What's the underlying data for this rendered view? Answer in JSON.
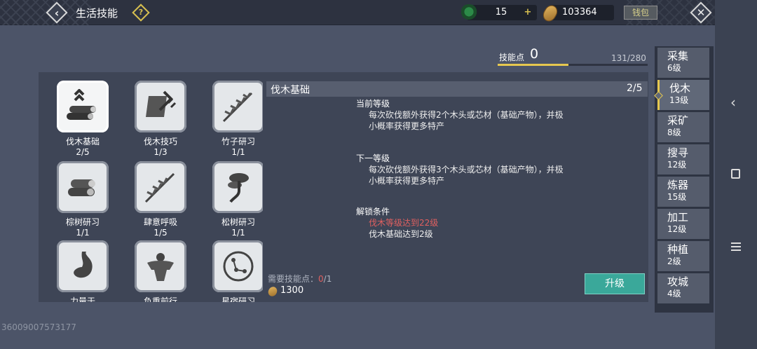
{
  "header": {
    "title": "生活技能",
    "help_glyph": "?",
    "jade_count": "15",
    "plus_glyph": "+",
    "coin_count": "103364",
    "wallet_label": "钱包"
  },
  "skill_points": {
    "label": "技能点",
    "value": "0",
    "count": "131/280",
    "fill_fraction": 0.47
  },
  "skills": [
    {
      "name": "伐木基础",
      "level": "2/5",
      "icon": "logs-icon"
    },
    {
      "name": "伐木技巧",
      "level": "1/3",
      "icon": "axe-scroll-icon"
    },
    {
      "name": "竹子研习",
      "level": "1/1",
      "icon": "bamboo-branch-icon"
    },
    {
      "name": "棕树研习",
      "level": "1/1",
      "icon": "log-pile-icon"
    },
    {
      "name": "肆意呼吸",
      "level": "1/5",
      "icon": "branch-icon"
    },
    {
      "name": "松树研习",
      "level": "1/1",
      "icon": "pine-tree-icon"
    },
    {
      "name": "力量于",
      "level": "",
      "icon": "stomach-icon"
    },
    {
      "name": "负重前行",
      "level": "",
      "icon": "muscle-icon"
    },
    {
      "name": "星宿研习",
      "level": "",
      "icon": "constellation-icon"
    }
  ],
  "detail": {
    "name": "伐木基础",
    "level": "2/5",
    "current_heading": "当前等级",
    "current_text": "每次砍伐额外获得2个木头或芯材（基础产物），并极小概率获得更多特产",
    "next_heading": "下一等级",
    "next_text": "每次砍伐额外获得3个木头或芯材（基础产物），并极小概率获得更多特产",
    "unlock_heading": "解锁条件",
    "unlock_cond1": "伐木等级达到22级",
    "unlock_cond2": "伐木基础达到2级",
    "cost_label": "需要技能点：",
    "cost_have": "0",
    "cost_need": "/1",
    "coin_cost": "1300",
    "upgrade_label": "升级"
  },
  "categories": [
    {
      "name": "采集",
      "level": "6级"
    },
    {
      "name": "伐木",
      "level": "13级"
    },
    {
      "name": "采矿",
      "level": "8级"
    },
    {
      "name": "搜寻",
      "level": "12级"
    },
    {
      "name": "炼器",
      "level": "15级"
    },
    {
      "name": "加工",
      "level": "12级"
    },
    {
      "name": "种植",
      "level": "2级"
    },
    {
      "name": "攻城",
      "level": "4级"
    }
  ],
  "uid": "36009007573177",
  "colors": {
    "accent": "#e6c84f",
    "upgrade_button": "#3aa89a",
    "warning": "#e06060"
  }
}
